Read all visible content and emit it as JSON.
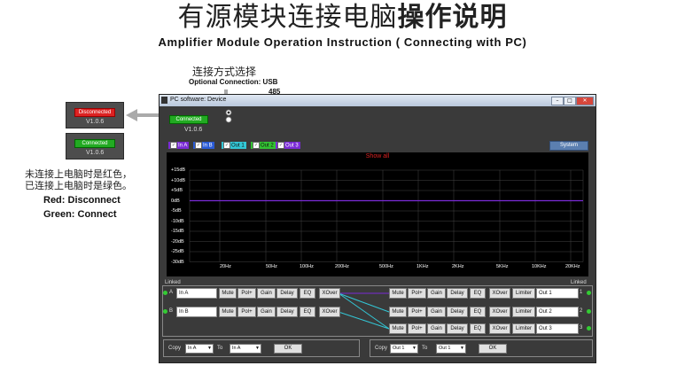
{
  "header": {
    "title_normal": "有源模块连接电脑",
    "title_bold": "操作说明",
    "subtitle": "Amplifier Module Operation Instruction ( Connecting with PC)"
  },
  "option": {
    "cn": "连接方式选择",
    "en": "Optional Connection: USB",
    "alt": "485"
  },
  "status_panels": {
    "disconnected_label": "Disconnected",
    "disconnected_version": "V1.0.6",
    "connected_label": "Connected",
    "connected_version": "V1.0.6"
  },
  "note": {
    "cn_line1": "未连接上电脑时是红色，",
    "cn_line2": "已连接上电脑时是绿色。",
    "red": "Red: Disconnect",
    "green": "Green: Connect"
  },
  "window": {
    "title": "PC software:  Device",
    "connected_label": "Connected",
    "version": "V1.0.6",
    "system_button": "System",
    "show_all": "Show all",
    "channels": [
      {
        "label": "In A",
        "color": "#7a2bd6"
      },
      {
        "label": "In B",
        "color": "#2a5bd6"
      },
      {
        "label": "Out 1",
        "color": "#33c7d6"
      },
      {
        "label": "Out 2",
        "color": "#33c233"
      },
      {
        "label": "Out 3",
        "color": "#7a2bd6"
      }
    ],
    "y_ticks": [
      "+15dB",
      "+10dB",
      "+5dB",
      "0dB",
      "-5dB",
      "-10dB",
      "-15dB",
      "-20dB",
      "-25dB",
      "-30dB"
    ],
    "x_ticks": [
      "20Hz",
      "50Hz",
      "100Hz",
      "200Hz",
      "500Hz",
      "1KHz",
      "2KHz",
      "5KHz",
      "10KHz",
      "20KHz"
    ],
    "linked_left": "Linked",
    "linked_right": "Linked",
    "inputs": [
      {
        "letter": "A",
        "name": "In A"
      },
      {
        "letter": "B",
        "name": "In B"
      }
    ],
    "outputs": [
      {
        "num": "1",
        "name": "Out 1"
      },
      {
        "num": "2",
        "name": "Out 2"
      },
      {
        "num": "3",
        "name": "Out 3"
      }
    ],
    "btn": {
      "mute": "Mute",
      "pol": "Pol+",
      "gain": "Gain",
      "delay": "Delay",
      "eq": "EQ",
      "xover": "XOver",
      "limiter": "Limiter"
    },
    "copy_left": {
      "copy": "Copy",
      "from": "In A",
      "to": "To",
      "to_val": "In A",
      "ok": "OK"
    },
    "copy_right": {
      "copy": "Copy",
      "from": "Out 1",
      "to": "To",
      "to_val": "Out 1",
      "ok": "OK"
    }
  },
  "colors": {
    "accent_red": "#dd2222",
    "accent_green": "#22aa22",
    "curve": "#7a2bd6",
    "link_line": "#33c7d6"
  }
}
